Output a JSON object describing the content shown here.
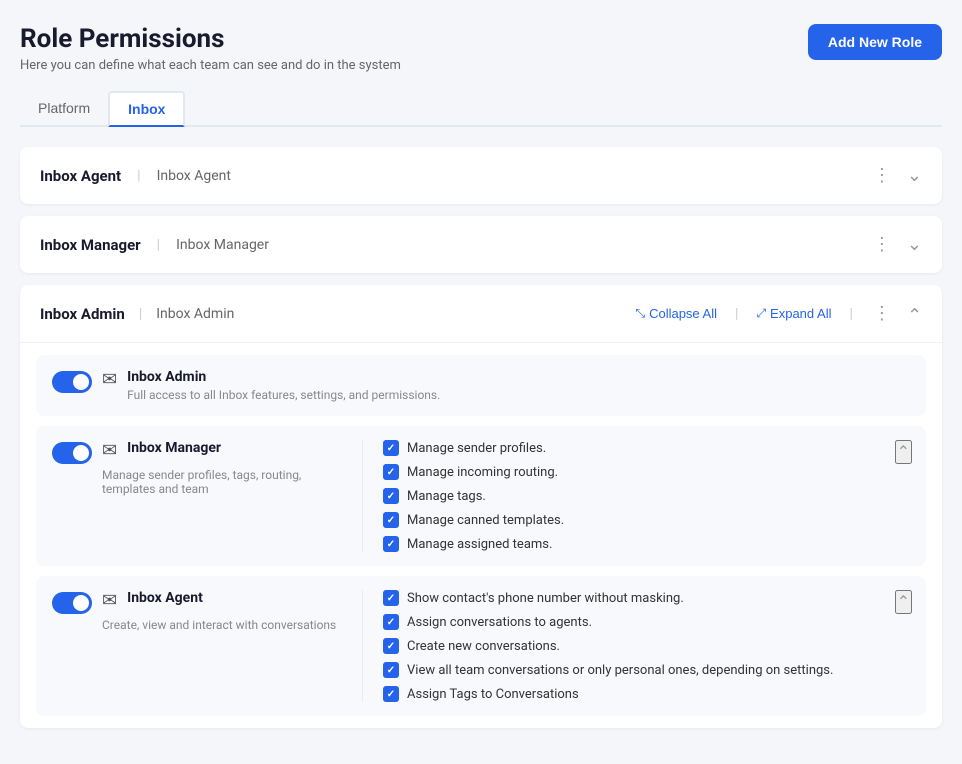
{
  "page": {
    "title": "Role Permissions",
    "subtitle": "Here you can define what each team can see and do in the system",
    "add_new_role_label": "Add New Role"
  },
  "tabs": [
    {
      "id": "platform",
      "label": "Platform",
      "active": false
    },
    {
      "id": "inbox",
      "label": "Inbox",
      "active": true
    }
  ],
  "roles": [
    {
      "id": "inbox-agent",
      "name": "Inbox Agent",
      "label": "Inbox Agent",
      "expanded": false
    },
    {
      "id": "inbox-manager",
      "name": "Inbox Manager",
      "label": "Inbox Manager",
      "expanded": false
    }
  ],
  "admin_section": {
    "name": "Inbox Admin",
    "label": "Inbox Admin",
    "collapse_all_label": "Collapse All",
    "expand_all_label": "Expand All",
    "permission_cards": [
      {
        "id": "inbox-admin-card",
        "title": "Inbox Admin",
        "description": "Full access to all Inbox features, settings, and permissions.",
        "enabled": true,
        "permissions": []
      },
      {
        "id": "inbox-manager-card",
        "title": "Inbox Manager",
        "description": "Manage sender profiles, tags, routing, templates and team",
        "enabled": true,
        "expanded": true,
        "permissions": [
          "Manage sender profiles.",
          "Manage incoming routing.",
          "Manage tags.",
          "Manage canned templates.",
          "Manage assigned teams."
        ]
      },
      {
        "id": "inbox-agent-card",
        "title": "Inbox Agent",
        "description": "Create, view and interact with conversations",
        "enabled": true,
        "expanded": true,
        "permissions": [
          "Show contact's phone number without masking.",
          "Assign conversations to agents.",
          "Create new conversations.",
          "View all team conversations or only personal ones, depending on settings.",
          "Assign Tags to Conversations"
        ]
      }
    ]
  }
}
